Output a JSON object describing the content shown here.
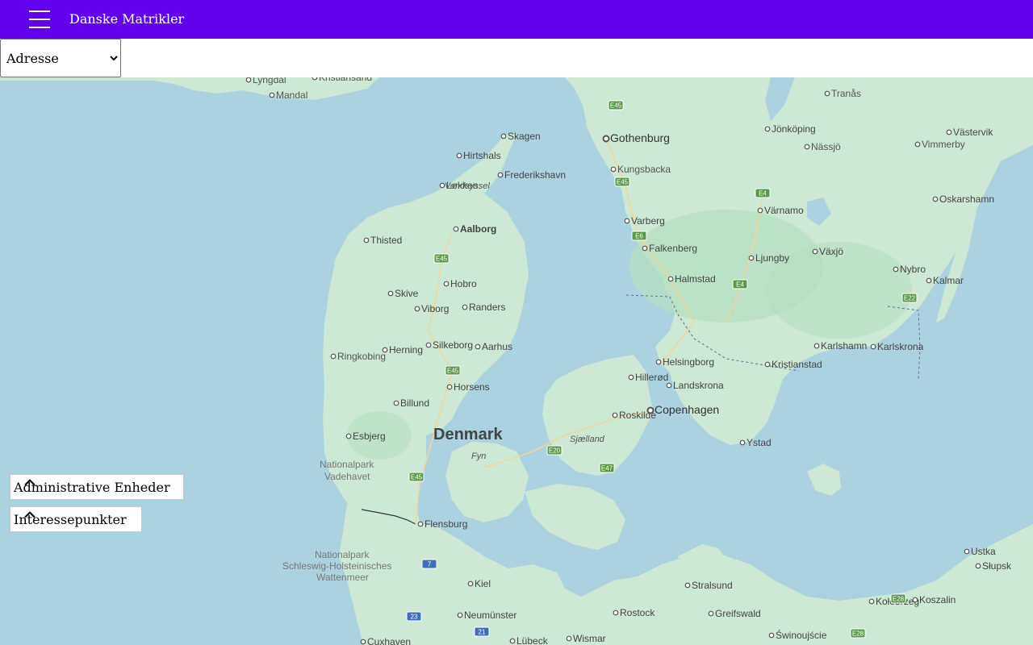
{
  "appbar": {
    "title": "Danske Matrikler",
    "menu_icon": "hamburger-menu-icon",
    "color": "#6200ee"
  },
  "search": {
    "selected": "Adresse"
  },
  "panels": {
    "admin_label": "Administrative Enheder",
    "poi_label": "Interessepunkter",
    "chevron_icon": "chevron-up-icon"
  },
  "map": {
    "water_color": "#aad3df",
    "land_color": "#cde8d4",
    "country_label": "Denmark",
    "cities": [
      {
        "name": "Skagen"
      },
      {
        "name": "Hirtshals"
      },
      {
        "name": "Frederikshavn"
      },
      {
        "name": "Løkken"
      },
      {
        "name": "Aalborg"
      },
      {
        "name": "Thisted"
      },
      {
        "name": "Hobro"
      },
      {
        "name": "Skive"
      },
      {
        "name": "Viborg"
      },
      {
        "name": "Randers"
      },
      {
        "name": "Silkeborg"
      },
      {
        "name": "Aarhus"
      },
      {
        "name": "Herning"
      },
      {
        "name": "Ringkobing"
      },
      {
        "name": "Horsens"
      },
      {
        "name": "Billund"
      },
      {
        "name": "Esbjerg"
      },
      {
        "name": "Flensburg"
      },
      {
        "name": "Kiel"
      },
      {
        "name": "Neumünster"
      },
      {
        "name": "Lübeck"
      },
      {
        "name": "Cuxhaven"
      },
      {
        "name": "Wismar"
      },
      {
        "name": "Rostock"
      },
      {
        "name": "Stralsund"
      },
      {
        "name": "Greifswald"
      },
      {
        "name": "Świnoujście"
      },
      {
        "name": "Kołobrzeg"
      },
      {
        "name": "Koszalin"
      },
      {
        "name": "Ustka"
      },
      {
        "name": "Słupsk"
      },
      {
        "name": "Hillerød"
      },
      {
        "name": "Roskilde"
      },
      {
        "name": "Copenhagen"
      },
      {
        "name": "Helsingborg"
      },
      {
        "name": "Landskrona"
      },
      {
        "name": "Ystad"
      },
      {
        "name": "Kristianstad"
      },
      {
        "name": "Karlshamn"
      },
      {
        "name": "Karlskrona"
      },
      {
        "name": "Halmstad"
      },
      {
        "name": "Falkenberg"
      },
      {
        "name": "Varberg"
      },
      {
        "name": "Ljungby"
      },
      {
        "name": "Växjö"
      },
      {
        "name": "Nybro"
      },
      {
        "name": "Kalmar"
      },
      {
        "name": "Värnamo"
      },
      {
        "name": "Oskarshamn"
      },
      {
        "name": "Gothenburg"
      },
      {
        "name": "Kungsbacka"
      },
      {
        "name": "Jönköping"
      },
      {
        "name": "Nässjö"
      },
      {
        "name": "Vimmerby"
      },
      {
        "name": "Västervik"
      },
      {
        "name": "Tranås"
      },
      {
        "name": "Lyngdal"
      },
      {
        "name": "Kristiansand"
      },
      {
        "name": "Mandal"
      }
    ],
    "regions": [
      "Vendsyssel",
      "Sjælland",
      "Fyn"
    ],
    "parks": [
      "Nationalpark Vadehavet",
      "Nationalpark Schleswig-Holsteinisches Wattenmeer"
    ],
    "roads": [
      "E45",
      "E45",
      "E45",
      "E45",
      "E20",
      "E47",
      "E6",
      "E4",
      "E4",
      "E22",
      "E45",
      "E6",
      "E28",
      "E28",
      "7",
      "23",
      "21"
    ]
  }
}
